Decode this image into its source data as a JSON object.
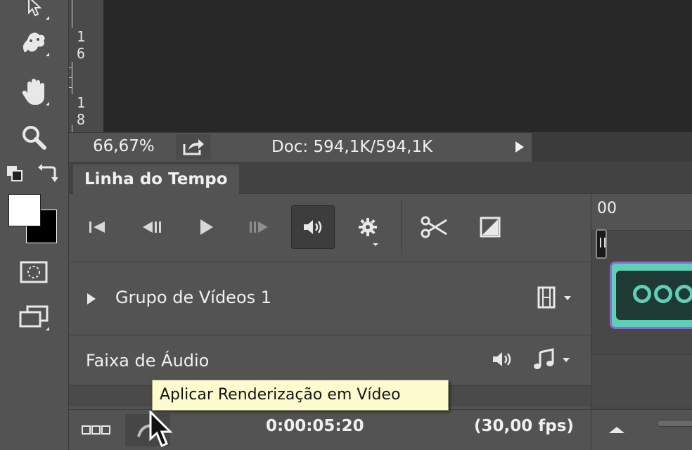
{
  "ruler": {
    "numbers": [
      "1",
      "6",
      "1",
      "8"
    ]
  },
  "status": {
    "zoom": "66,67%",
    "doc": "Doc: 594,1K/594,1K"
  },
  "timeline": {
    "tab_label": "Linha do Tempo",
    "time_marker": "00",
    "tracks": {
      "video_group": "Grupo de Vídeos 1",
      "audio_track": "Faixa de Áudio"
    },
    "timecode": "0:00:05:20",
    "fps": "(30,00 fps)",
    "tooltip": "Aplicar Renderização em Vídeo"
  },
  "colors": {
    "panel_bg": "#535353",
    "canvas_bg": "#282828",
    "tooltip_bg": "#fefccf",
    "clip_accent": "#5fd0b6",
    "clip_border": "#8b6ad8"
  },
  "icons": {
    "toolbar": [
      "selection-arrow-icon",
      "puppet-warp-icon",
      "hand-icon",
      "zoom-icon",
      "default-colors-icon",
      "swap-colors-icon",
      "quick-mask-icon",
      "screen-mode-icon"
    ],
    "controls": [
      "go-to-first-frame-icon",
      "previous-frame-icon",
      "play-icon",
      "next-frame-icon",
      "audio-icon",
      "settings-gear-icon",
      "scissors-icon",
      "transition-icon"
    ]
  }
}
